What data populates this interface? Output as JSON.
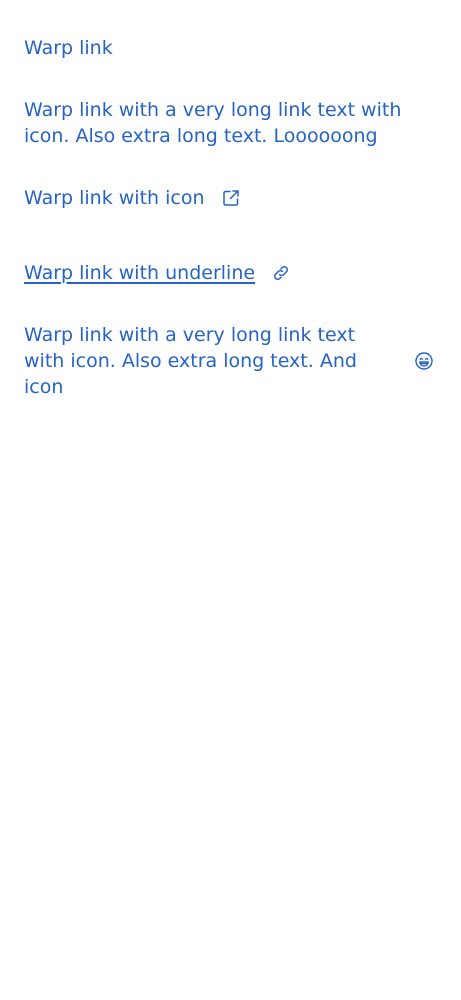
{
  "links": [
    {
      "text": "Warp link"
    },
    {
      "text": "Warp link with a very long link text with icon. Also extra long text. Loooooong"
    },
    {
      "text": "Warp link with icon",
      "icon": "external-link-icon"
    },
    {
      "text": "Warp link with underline",
      "icon": "link-chain-icon",
      "underline": true
    },
    {
      "text": "Warp link with a very long link text with icon. Also extra long text. And icon",
      "icon": "grinning-face-icon"
    }
  ],
  "colors": {
    "link": "#2563c6",
    "background": "#ffffff"
  }
}
